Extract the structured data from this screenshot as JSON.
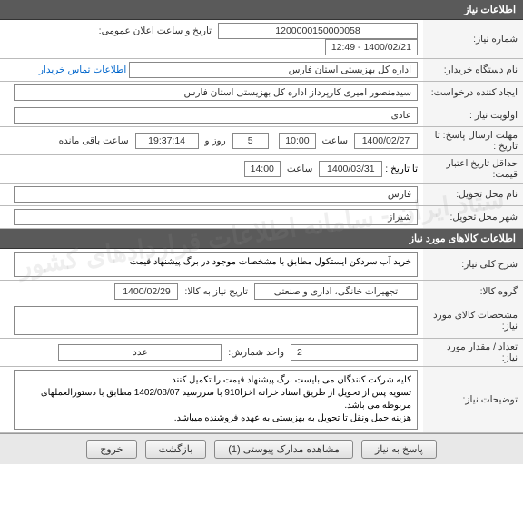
{
  "sections": {
    "need_info_title": "اطلاعات نیاز",
    "goods_info_title": "اطلاعات کالاهای مورد نیاز"
  },
  "need": {
    "number_label": "شماره نیاز:",
    "number": "1200000150000058",
    "public_datetime_label": "تاریخ و ساعت اعلان عمومی:",
    "public_datetime": "1400/02/21 - 12:49",
    "buyer_label": "نام دستگاه خریدار:",
    "buyer": "اداره کل بهزیستی استان فارس",
    "buyer_contact_link": "اطلاعات تماس خریدار",
    "requester_label": "ایجاد کننده درخواست:",
    "requester": "سیدمنصور امیری کارپرداز اداره کل بهزیستی استان فارس",
    "priority_label": "اولویت نیاز :",
    "priority": "عادی",
    "deadline_label": "مهلت ارسال پاسخ:",
    "to_date_label": "تا تاریخ :",
    "deadline_date": "1400/02/27",
    "time_label": "ساعت",
    "deadline_time": "10:00",
    "remaining_days": "5",
    "day_and_label": "روز و",
    "remaining_time": "19:37:14",
    "remaining_label": "ساعت باقی مانده",
    "min_validity_label": "حداقل تاریخ اعتبار قیمت:",
    "min_validity_date": "1400/03/31",
    "min_validity_time": "14:00",
    "delivery_state_label": "نام محل تحویل:",
    "delivery_state": "فارس",
    "delivery_city_label": "شهر محل تحویل:",
    "delivery_city": "شیراز"
  },
  "goods": {
    "general_desc_label": "شرح کلی نیاز:",
    "general_desc": "خرید آب سردکن ایستکول مطابق با مشخصات موجود در برگ پیشنهاد قیمت",
    "group_label": "گروه کالا:",
    "group": "تجهیزات خانگی، اداری و صنعتی",
    "need_by_label": "تاریخ نیاز به کالا:",
    "need_by": "1400/02/29",
    "spec_label": "مشخصات کالای مورد نیاز:",
    "spec": "",
    "qty_label": "تعداد / مقدار مورد نیاز:",
    "qty": "2",
    "unit_label": "واحد شمارش:",
    "unit": "عدد",
    "notes_label": "توضیحات نیاز:",
    "notes": "کلیه شرکت کنندگان می بایست برگ پیشنهاد قیمت را تکمیل کنند\nتسویه پس از تحویل از طریق اسناد خزانه اخزا910 با سررسید 1402/08/07 مطابق با دستورالعملهای مربوطه می باشد.\nهزینه حمل ونقل تا تحویل به بهزیستی به عهده فروشنده میباشد."
  },
  "actions": {
    "respond": "پاسخ به نیاز",
    "view_attachments": "مشاهده مدارک پیوستی (1)",
    "return": "بازگشت",
    "exit": "خروج"
  }
}
